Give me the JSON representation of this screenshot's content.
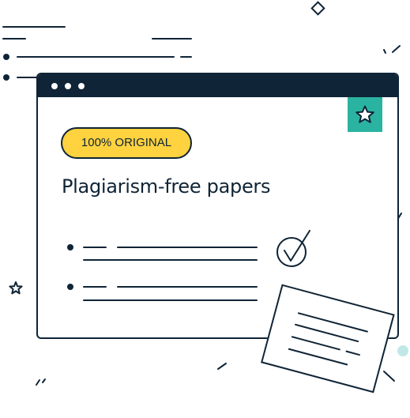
{
  "badge": {
    "label": "100% ORIGINAL"
  },
  "headline": "Plagiarism-free papers",
  "icons": {
    "window_controls": [
      "dot-icon",
      "dot-icon",
      "dot-icon"
    ],
    "corner": "star-icon",
    "check": "checkmark-circle-icon",
    "outline_star": "star-outline-icon",
    "document": "document-card-icon"
  },
  "colors": {
    "navy": "#0f2436",
    "yellow": "#ffd23f",
    "teal": "#2ab3a0",
    "light_teal": "#bfe8e6",
    "white": "#ffffff"
  }
}
